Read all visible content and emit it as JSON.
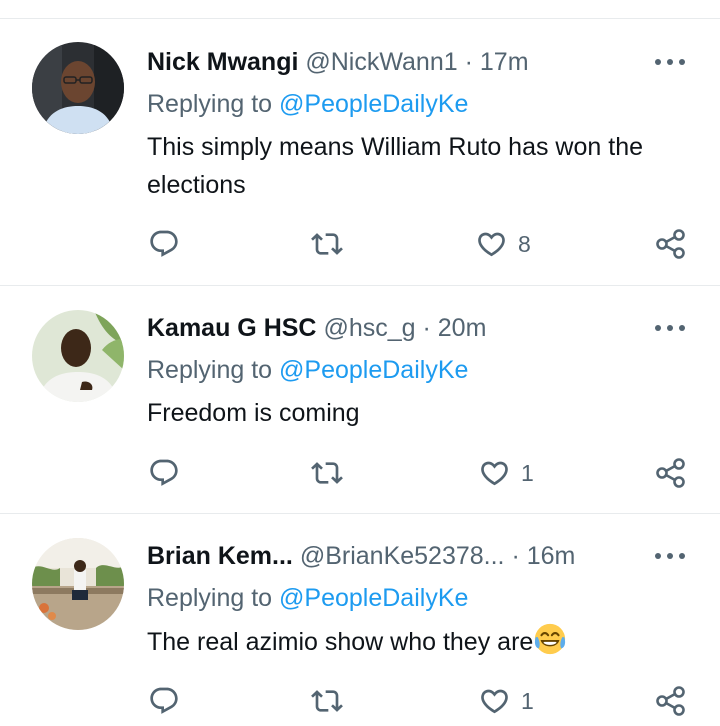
{
  "tweets": [
    {
      "name": "Nick Mwangi",
      "handle": "@NickWann1",
      "separator": "·",
      "time": "17m",
      "replying_prefix": "Replying to",
      "replying_to": "@PeopleDailyKe",
      "text": "This simply means William Ruto has won the elections",
      "like_count": "8",
      "avatar": "avatar-man-in-car"
    },
    {
      "name": "Kamau G HSC",
      "handle": "@hsc_g",
      "separator": "·",
      "time": "20m",
      "replying_prefix": "Replying to",
      "replying_to": "@PeopleDailyKe",
      "text": "Freedom is coming",
      "like_count": "1",
      "avatar": "avatar-man-white-shirt"
    },
    {
      "name": "Brian Kem...",
      "handle": "@BrianKe52378...",
      "separator": "·",
      "time": "16m",
      "replying_prefix": "Replying to",
      "replying_to": "@PeopleDailyKe",
      "text": "The real azimio show who they are",
      "text_emoji": "face-with-tears-of-joy",
      "like_count": "1",
      "avatar": "avatar-man-sitting-outdoors"
    }
  ],
  "icons": {
    "more": "more-icon",
    "reply": "reply-icon",
    "retweet": "retweet-icon",
    "like": "like-icon",
    "share": "share-icon"
  },
  "colors": {
    "text_primary": "#0f1419",
    "text_secondary": "#536471",
    "mention": "#1d9bf0",
    "divider": "#e8ebed"
  }
}
